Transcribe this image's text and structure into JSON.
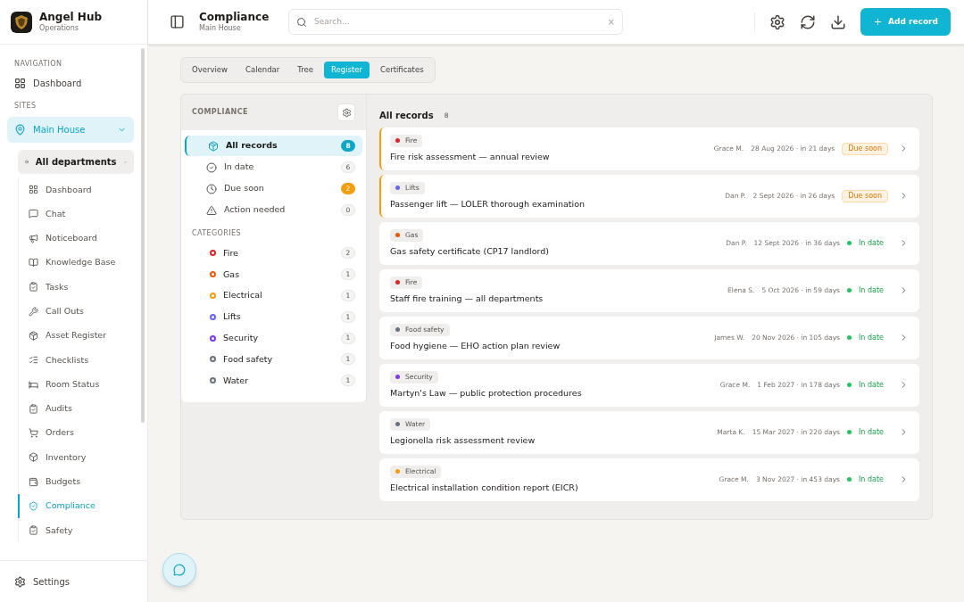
{
  "app": {
    "name": "Angel Hub",
    "subtitle": "Operations"
  },
  "header": {
    "title": "Compliance",
    "subtitle": "Main House",
    "search": {
      "placeholder": "Search..."
    },
    "clear": "×",
    "add_button": "Add record"
  },
  "sidebar": {
    "navigation_label": "NAVIGATION",
    "dashboard": "Dashboard",
    "sites_label": "SITES",
    "site": {
      "label": "Main House",
      "expanded": true
    },
    "department": "All departments",
    "items": [
      {
        "label": "Dashboard",
        "selected": false
      },
      {
        "label": "Chat",
        "selected": false
      },
      {
        "label": "Noticeboard",
        "selected": false
      },
      {
        "label": "Knowledge Base",
        "selected": false
      },
      {
        "label": "Tasks",
        "selected": false
      },
      {
        "label": "Call Outs",
        "selected": false
      },
      {
        "label": "Asset Register",
        "selected": false
      },
      {
        "label": "Checklists",
        "selected": false
      },
      {
        "label": "Room Status",
        "selected": false
      },
      {
        "label": "Audits",
        "selected": false
      },
      {
        "label": "Orders",
        "selected": false
      },
      {
        "label": "Inventory",
        "selected": false
      },
      {
        "label": "Budgets",
        "selected": false
      },
      {
        "label": "Compliance",
        "selected": true
      },
      {
        "label": "Safety",
        "selected": false
      }
    ],
    "settings": "Settings"
  },
  "tabs": [
    {
      "label": "Overview",
      "selected": false
    },
    {
      "label": "Calendar",
      "selected": false
    },
    {
      "label": "Tree",
      "selected": false
    },
    {
      "label": "Register",
      "selected": true
    },
    {
      "label": "Certificates",
      "selected": false
    }
  ],
  "filter_panel": {
    "title": "COMPLIANCE",
    "filters": [
      {
        "kind": "all",
        "label": "All records",
        "count": "8",
        "selected": true
      },
      {
        "kind": "in_date",
        "label": "In date",
        "count": "6",
        "selected": false
      },
      {
        "kind": "due_soon",
        "label": "Due soon",
        "count": "2",
        "selected": false
      },
      {
        "kind": "action",
        "label": "Action needed",
        "count": "0",
        "selected": false
      }
    ],
    "categories_label": "CATEGORIES",
    "categories": [
      {
        "label": "Fire",
        "count": "2",
        "color": "#dc2626"
      },
      {
        "label": "Gas",
        "count": "1",
        "color": "#ea580c"
      },
      {
        "label": "Electrical",
        "count": "1",
        "color": "#f59e0b"
      },
      {
        "label": "Lifts",
        "count": "1",
        "color": "#6366f1"
      },
      {
        "label": "Security",
        "count": "1",
        "color": "#7c3aed"
      },
      {
        "label": "Food safety",
        "count": "1",
        "color": "#6b7280"
      },
      {
        "label": "Water",
        "count": "1",
        "color": "#6b7280"
      }
    ]
  },
  "records": {
    "title": "All records",
    "count": "8",
    "items": [
      {
        "category": "Fire",
        "color": "#dc2626",
        "title": "Fire risk assessment — annual review",
        "owner": "Grace M.",
        "due": "28 Aug 2026 · in 21 days",
        "status": "Due soon",
        "kind": "due_soon"
      },
      {
        "category": "Lifts",
        "color": "#6366f1",
        "title": "Passenger lift — LOLER thorough examination",
        "owner": "Dan P.",
        "due": "2 Sept 2026 · in 26 days",
        "status": "Due soon",
        "kind": "due_soon"
      },
      {
        "category": "Gas",
        "color": "#ea580c",
        "title": "Gas safety certificate (CP17 landlord)",
        "owner": "Dan P.",
        "due": "12 Sept 2026 · in 36 days",
        "status": "In date",
        "kind": "in_date"
      },
      {
        "category": "Fire",
        "color": "#dc2626",
        "title": "Staff fire training — all departments",
        "owner": "Elena S.",
        "due": "5 Oct 2026 · in 59 days",
        "status": "In date",
        "kind": "in_date"
      },
      {
        "category": "Food safety",
        "color": "#6b7280",
        "title": "Food hygiene — EHO action plan review",
        "owner": "James W.",
        "due": "20 Nov 2026 · in 105 days",
        "status": "In date",
        "kind": "in_date"
      },
      {
        "category": "Security",
        "color": "#7c3aed",
        "title": "Martyn's Law — public protection procedures",
        "owner": "Grace M.",
        "due": "1 Feb 2027 · in 178 days",
        "status": "In date",
        "kind": "in_date"
      },
      {
        "category": "Water",
        "color": "#6b7280",
        "title": "Legionella risk assessment review",
        "owner": "Marta K.",
        "due": "15 Mar 2027 · in 220 days",
        "status": "In date",
        "kind": "in_date"
      },
      {
        "category": "Electrical",
        "color": "#f59e0b",
        "title": "Electrical installation condition report (EICR)",
        "owner": "Grace M.",
        "due": "3 Nov 2027 · in 453 days",
        "status": "In date",
        "kind": "in_date"
      }
    ]
  }
}
